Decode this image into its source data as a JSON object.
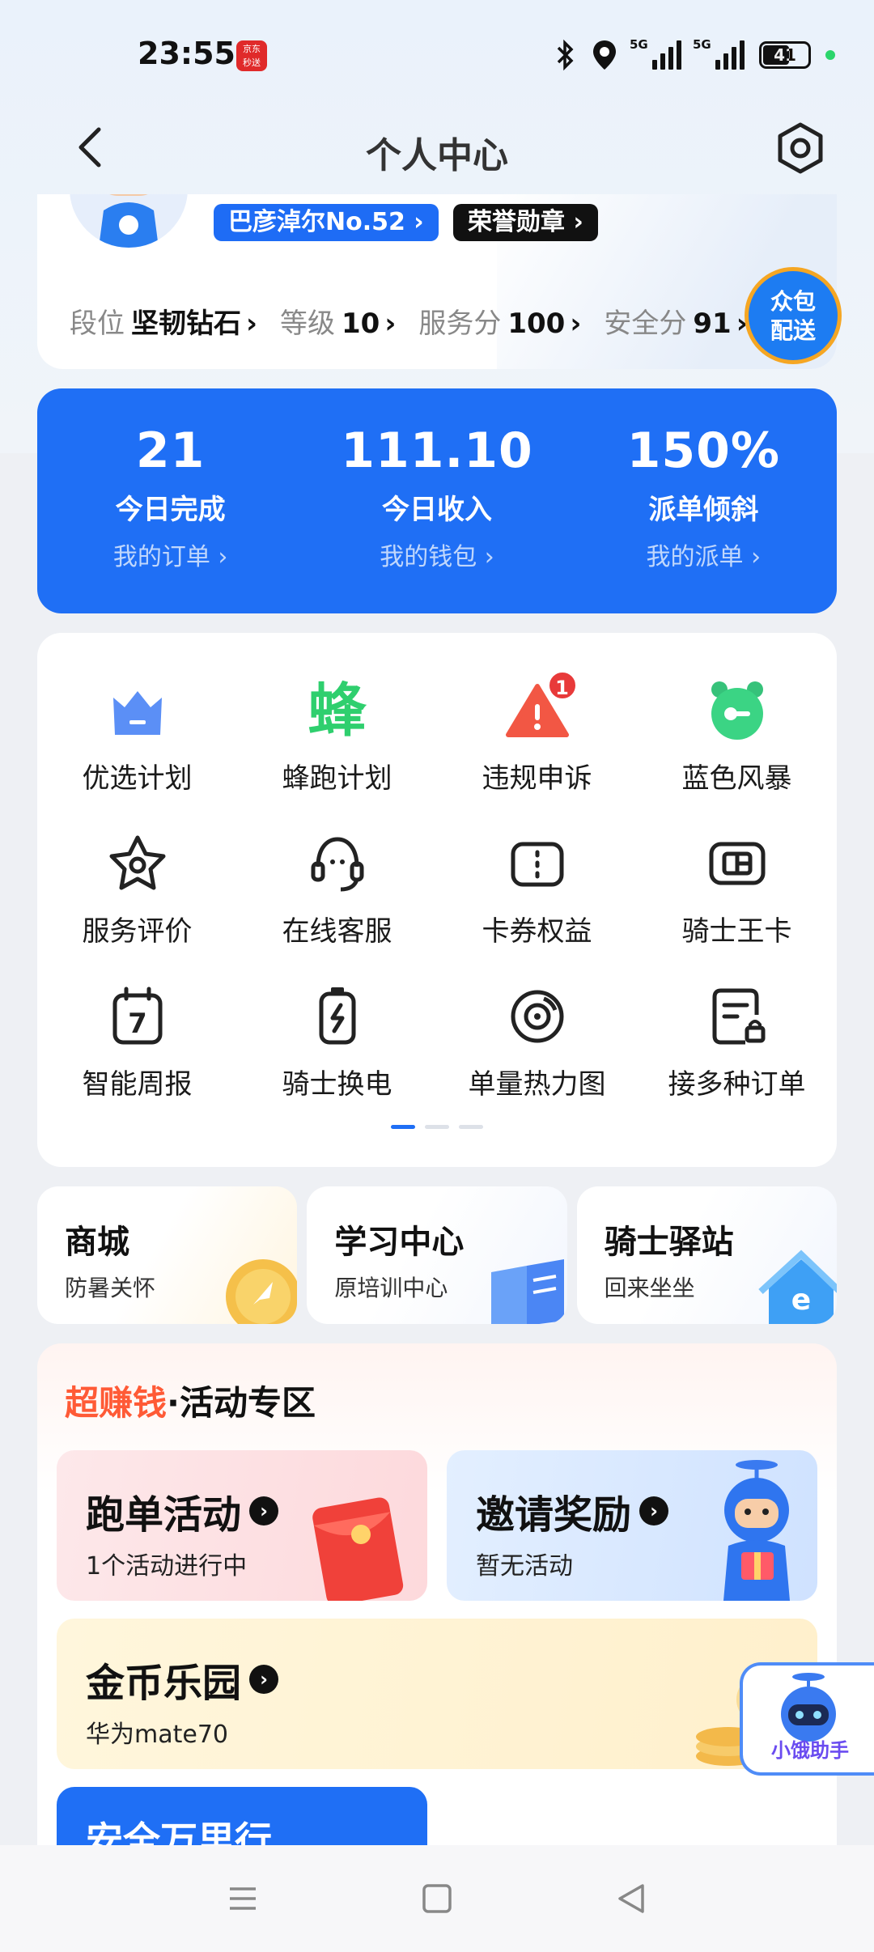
{
  "status_bar": {
    "time": "23:55",
    "app_icon_text": "京东\n秒送",
    "network_1": "5G",
    "network_2": "5G",
    "battery": "41"
  },
  "nav": {
    "title": "个人中心"
  },
  "profile": {
    "name": "巴彦淖尔No.52 ›",
    "honor": "荣誉勋章 ›",
    "stats": [
      {
        "label": "段位",
        "value": "坚韧钻石",
        "arrow": "›"
      },
      {
        "label": "等级",
        "value": "10",
        "arrow": "›"
      },
      {
        "label": "服务分",
        "value": "100",
        "arrow": "›"
      },
      {
        "label": "安全分",
        "value": "91",
        "arrow": "›"
      }
    ],
    "delivery_badge": "众包\n配送"
  },
  "summary": [
    {
      "value": "21",
      "label": "今日完成",
      "link": "我的订单 ›"
    },
    {
      "value": "111.10",
      "label": "今日收入",
      "link": "我的钱包 ›"
    },
    {
      "value": "150%",
      "label": "派单倾斜",
      "link": "我的派单 ›"
    }
  ],
  "grid": [
    {
      "label": "优选计划",
      "icon": "crown-icon"
    },
    {
      "label": "蜂跑计划",
      "icon": "bee-icon",
      "glyph": "蜂"
    },
    {
      "label": "违规申诉",
      "icon": "warning-icon",
      "badge": "1"
    },
    {
      "label": "蓝色风暴",
      "icon": "alarm-clock-icon"
    },
    {
      "label": "服务评价",
      "icon": "star-badge-icon"
    },
    {
      "label": "在线客服",
      "icon": "headset-icon"
    },
    {
      "label": "卡券权益",
      "icon": "coupon-icon"
    },
    {
      "label": "骑士王卡",
      "icon": "sim-card-icon"
    },
    {
      "label": "智能周报",
      "icon": "calendar-icon",
      "glyph": "7"
    },
    {
      "label": "骑士换电",
      "icon": "battery-swap-icon"
    },
    {
      "label": "单量热力图",
      "icon": "target-icon"
    },
    {
      "label": "接多种订单",
      "icon": "document-lock-icon"
    }
  ],
  "quick_cards": [
    {
      "title": "商城",
      "subtitle": "防暑关怀"
    },
    {
      "title": "学习中心",
      "subtitle": "原培训中心"
    },
    {
      "title": "骑士驿站",
      "subtitle": "回来坐坐"
    }
  ],
  "activity": {
    "title_red": "超赚钱",
    "title_rest": "·活动专区",
    "run": {
      "title": "跑单活动",
      "subtitle": "1个活动进行中"
    },
    "invite": {
      "title": "邀请奖励",
      "subtitle": "暂无活动"
    },
    "coin": {
      "title": "金币乐园",
      "subtitle": "华为mate70"
    },
    "safe": {
      "title": "安全万里行"
    },
    "arrow": "›"
  },
  "assistant": {
    "label": "小饿助手"
  },
  "colors": {
    "primary": "#1f6ff5",
    "red": "#ff5a36",
    "badge": "#e83a3a"
  }
}
